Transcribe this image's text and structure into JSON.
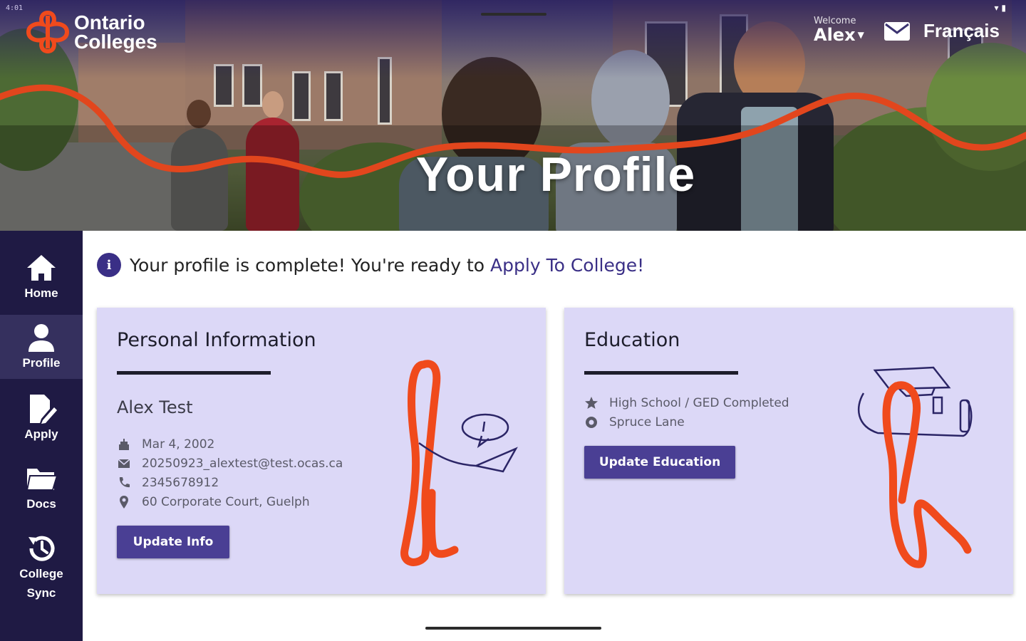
{
  "status_bar": {
    "time": "4:01"
  },
  "header": {
    "logo_line1": "Ontario",
    "logo_line2": "Colleges",
    "welcome_label": "Welcome",
    "user_name": "Alex",
    "language_link": "Français",
    "hero_title": "Your Profile"
  },
  "sidebar": {
    "items": [
      {
        "label": "Home",
        "icon": "home-icon"
      },
      {
        "label": "Profile",
        "icon": "user-icon",
        "active": true
      },
      {
        "label": "Apply",
        "icon": "apply-icon"
      },
      {
        "label": "Docs",
        "icon": "folder-icon"
      },
      {
        "label": "College",
        "label2": "Sync",
        "icon": "history-icon"
      }
    ]
  },
  "notice": {
    "text": "Your profile is complete! You're ready to",
    "link": "Apply To College!"
  },
  "personal_card": {
    "title": "Personal Information",
    "name": "Alex Test",
    "birthdate": "Mar 4, 2002",
    "email": "20250923_alextest@test.ocas.ca",
    "phone": "2345678912",
    "address": "60 Corporate Court, Guelph",
    "button": "Update Info"
  },
  "education_card": {
    "title": "Education",
    "status": "High School / GED Completed",
    "school": "Spruce Lane",
    "button": "Update Education"
  },
  "colors": {
    "sidebar_bg": "#1f1a44",
    "accent": "#4a3f94",
    "card_bg": "#dcd8f7",
    "brand_orange": "#f04a1c"
  }
}
